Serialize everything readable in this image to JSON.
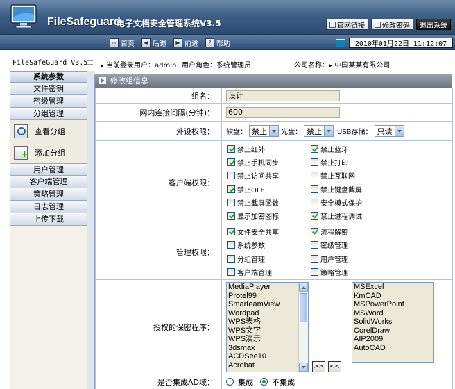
{
  "header": {
    "brand": "FileSafeguard",
    "product": "电子文档安全管理系统V3.5",
    "links": [
      {
        "label": "官网链接"
      },
      {
        "label": "修改密码"
      },
      {
        "label": "退出系统"
      }
    ]
  },
  "nav": {
    "items": [
      {
        "label": "首页",
        "icon": "home-icon"
      },
      {
        "label": "后退",
        "icon": "back-arrow-icon"
      },
      {
        "label": "前进",
        "icon": "forward-arrow-icon"
      },
      {
        "label": "帮助",
        "icon": "help-icon"
      }
    ],
    "datetime": "2010年01月22日 11:12:07"
  },
  "info": {
    "version": "FileSafeGuard V3.5",
    "login_user": "当前登录用户：admin",
    "user_role": "用户角色：系统管理员",
    "company": "公司名称：▸ 中国某某有限公司"
  },
  "sidebar": {
    "header": "系统参数",
    "items_top": [
      "文件密钥",
      "密级管理",
      "分组管理"
    ],
    "sub_items": [
      "查看分组",
      "添加分组"
    ],
    "items_bottom": [
      "用户管理",
      "客户端管理",
      "策略管理",
      "日志管理",
      "上传下载"
    ]
  },
  "main": {
    "title": "修改组信息",
    "group_name_label": "组名：",
    "group_name_value": "设计",
    "interval_label": "网内连接间隔(分钟)：",
    "interval_value": "600",
    "device_label": "外设权限：",
    "device": {
      "soft_label": "软盘：",
      "soft_value": "禁止",
      "cd_label": "光盘：",
      "cd_value": "禁止",
      "usb_label": "USB存储：",
      "usb_value": "只读"
    },
    "client_label": "客户端权限：",
    "client_perms": [
      {
        "label": "禁止红外",
        "checked": true
      },
      {
        "label": "禁止蓝牙",
        "checked": true
      },
      {
        "label": "禁止手机同步",
        "checked": true
      },
      {
        "label": "禁止打印",
        "checked": false
      },
      {
        "label": "禁止访问共享",
        "checked": false
      },
      {
        "label": "禁止互联网",
        "checked": false
      },
      {
        "label": "禁止OLE",
        "checked": true
      },
      {
        "label": "禁止键盘截屏",
        "checked": false
      },
      {
        "label": "禁止截屏函数",
        "checked": false
      },
      {
        "label": "安全模式保护",
        "checked": false
      },
      {
        "label": "显示加密图标",
        "checked": true
      },
      {
        "label": "禁止进程调试",
        "checked": true
      }
    ],
    "manage_label": "管理权限：",
    "manage_perms": [
      {
        "label": "文件安全共享",
        "checked": true
      },
      {
        "label": "流程解密",
        "checked": true
      },
      {
        "label": "系统参数",
        "checked": false
      },
      {
        "label": "密级管理",
        "checked": false
      },
      {
        "label": "分组管理",
        "checked": false
      },
      {
        "label": "用户管理",
        "checked": false
      },
      {
        "label": "客户端管理",
        "checked": false
      },
      {
        "label": "策略管理",
        "checked": false
      }
    ],
    "programs_label": "授权的保密程序：",
    "available_programs": [
      "MediaPlayer",
      "Protel99",
      "SmarteamView",
      "Wordpad",
      "WPS表格",
      "WPS文字",
      "WPS演示",
      "3dsmax",
      "ACDSee10",
      "Acrobat"
    ],
    "authorized_programs": [
      "MSExcel",
      "KmCAD",
      "MSPowerPoint",
      "MSWord",
      "SolidWorks",
      "CorelDraw",
      "AIP2009",
      "AutoCAD"
    ],
    "add_btn": ">>",
    "remove_btn": "<<",
    "ad_label": "是否集成AD域：",
    "ad_options": [
      {
        "label": "集成",
        "checked": false
      },
      {
        "label": "不集成",
        "checked": true
      }
    ]
  }
}
